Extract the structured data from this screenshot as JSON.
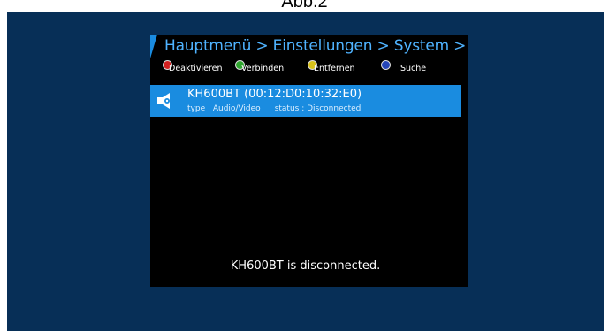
{
  "caption": "Abb.2",
  "header": {
    "breadcrumb": "Hauptmenü > Einstellungen > System > Bluetooth"
  },
  "hotkeys": [
    {
      "label": "Deaktivieren",
      "color": "#d22020"
    },
    {
      "label": "Verbinden",
      "color": "#2ea52e"
    },
    {
      "label": "Entfernen",
      "color": "#d8c21a"
    },
    {
      "label": "Suche",
      "color": "#2545b8"
    }
  ],
  "devices": [
    {
      "name": "KH600BT (00:12:D0:10:32:E0)",
      "type": "type : Audio/Video",
      "status": "status : Disconnected",
      "icon": "speaker-icon"
    }
  ],
  "status_message": "KH600BT is disconnected.",
  "colors": {
    "backdrop": "#072f57",
    "screen": "#000000",
    "selection": "#1a8ce0",
    "title_text": "#4fb3ff"
  }
}
